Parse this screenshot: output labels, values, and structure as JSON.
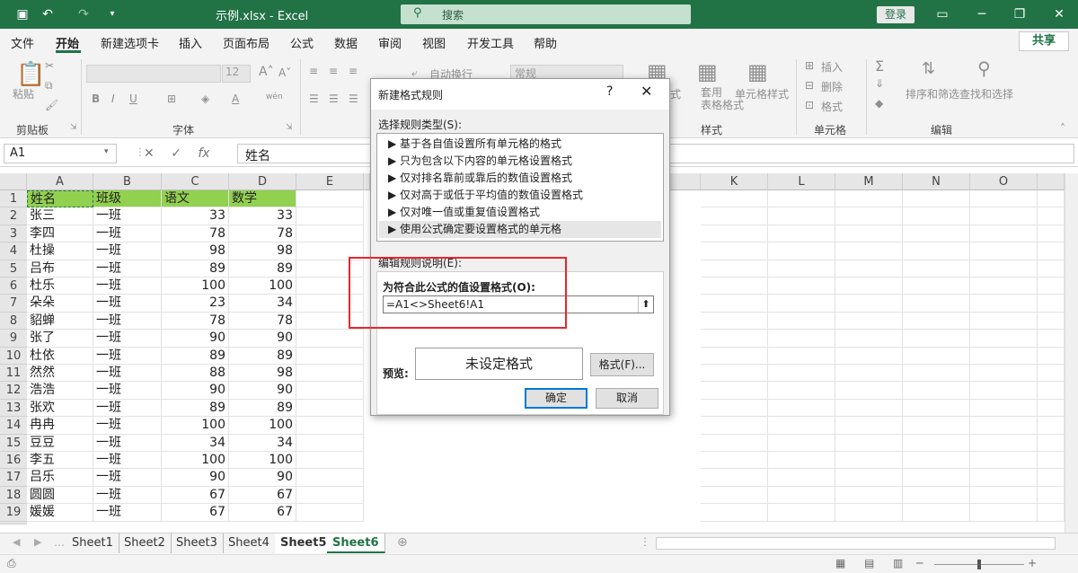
{
  "titlebar": {
    "title": "示例.xlsx  -  Excel",
    "search_placeholder": "搜索",
    "login": "登录"
  },
  "menu": [
    "文件",
    "开始",
    "新建选项卡",
    "插入",
    "页面布局",
    "公式",
    "数据",
    "审阅",
    "视图",
    "开发工具",
    "帮助"
  ],
  "share": "共享",
  "ribbon": {
    "paste": "粘贴",
    "clipboard": "剪贴板",
    "font_size": "12",
    "font": "字体",
    "wrap": "自动换行",
    "number_format": "常规",
    "conditional": "式",
    "table_format": "套用\n表格格式",
    "cell_style": "单元格样式",
    "styles": "样式",
    "insert": "插入",
    "delete": "删除",
    "format": "格式",
    "cells": "单元格",
    "sort_filter": "排序和筛选",
    "find_select": "查找和选择",
    "editing": "编辑"
  },
  "formula_bar": {
    "name_box": "A1",
    "fx": "fx",
    "content": "姓名"
  },
  "columns": [
    "A",
    "B",
    "C",
    "D",
    "E",
    "K",
    "L",
    "M",
    "N",
    "O"
  ],
  "rows": [
    {
      "n": "1",
      "a": "姓名",
      "b": "班级",
      "c": "语文",
      "d": "数学"
    },
    {
      "n": "2",
      "a": "张三",
      "b": "一班",
      "c": "33",
      "d": "33"
    },
    {
      "n": "3",
      "a": "李四",
      "b": "一班",
      "c": "78",
      "d": "78"
    },
    {
      "n": "4",
      "a": "杜操",
      "b": "一班",
      "c": "98",
      "d": "98"
    },
    {
      "n": "5",
      "a": "吕布",
      "b": "一班",
      "c": "89",
      "d": "89"
    },
    {
      "n": "6",
      "a": "杜乐",
      "b": "一班",
      "c": "100",
      "d": "100"
    },
    {
      "n": "7",
      "a": "朵朵",
      "b": "一班",
      "c": "23",
      "d": "34"
    },
    {
      "n": "8",
      "a": "貂蝉",
      "b": "一班",
      "c": "78",
      "d": "78"
    },
    {
      "n": "9",
      "a": "张了",
      "b": "一班",
      "c": "90",
      "d": "90"
    },
    {
      "n": "10",
      "a": "杜依",
      "b": "一班",
      "c": "89",
      "d": "89"
    },
    {
      "n": "11",
      "a": "然然",
      "b": "一班",
      "c": "88",
      "d": "98"
    },
    {
      "n": "12",
      "a": "浩浩",
      "b": "一班",
      "c": "90",
      "d": "90"
    },
    {
      "n": "13",
      "a": "张欢",
      "b": "一班",
      "c": "89",
      "d": "89"
    },
    {
      "n": "14",
      "a": "冉冉",
      "b": "一班",
      "c": "100",
      "d": "100"
    },
    {
      "n": "15",
      "a": "豆豆",
      "b": "一班",
      "c": "34",
      "d": "34"
    },
    {
      "n": "16",
      "a": "李五",
      "b": "一班",
      "c": "100",
      "d": "100"
    },
    {
      "n": "17",
      "a": "吕乐",
      "b": "一班",
      "c": "90",
      "d": "90"
    },
    {
      "n": "18",
      "a": "圆圆",
      "b": "一班",
      "c": "67",
      "d": "67"
    },
    {
      "n": "19",
      "a": "媛媛",
      "b": "一班",
      "c": "67",
      "d": "67"
    }
  ],
  "sheets": [
    "Sheet1",
    "Sheet2",
    "Sheet3",
    "Sheet4",
    "Sheet5",
    "Sheet6"
  ],
  "active_sheet": "Sheet6",
  "dialog": {
    "title": "新建格式规则",
    "help": "?",
    "close": "✕",
    "rule_type_label": "选择规则类型(S):",
    "rule_types": [
      "基于各自值设置所有单元格的格式",
      "只为包含以下内容的单元格设置格式",
      "仅对排名靠前或靠后的数值设置格式",
      "仅对高于或低于平均值的数值设置格式",
      "仅对唯一值或重复值设置格式",
      "使用公式确定要设置格式的单元格"
    ],
    "selected_rule": 5,
    "desc_label": "编辑规则说明(E):",
    "formula_label": "为符合此公式的值设置格式(O):",
    "formula_value": "=A1<>Sheet6!A1",
    "preview_label": "预览:",
    "preview_text": "未设定格式",
    "format_button": "格式(F)...",
    "ok": "确定",
    "cancel": "取消"
  },
  "colors": {
    "excel_green": "#217346",
    "header_fill": "#92d050",
    "highlight_box": "#e8262b"
  }
}
